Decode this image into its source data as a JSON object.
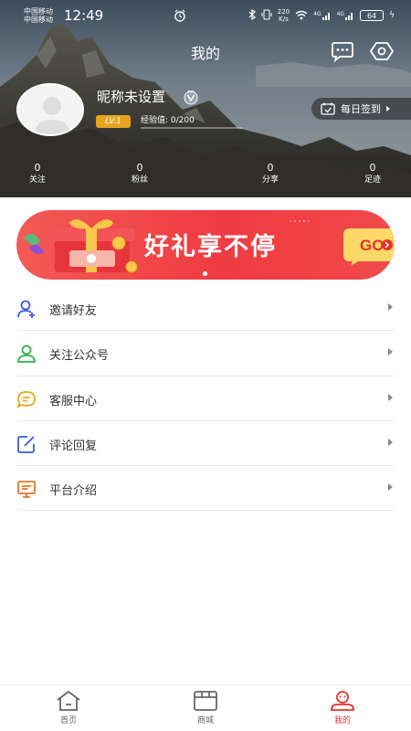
{
  "status_bar": {
    "carrier_1": "中国移动",
    "carrier_2": "中国移动",
    "time": "12:49",
    "net_speed_value": "220",
    "net_speed_unit": "K/s",
    "signal_1": "4G",
    "signal_2": "4G",
    "battery": "64"
  },
  "header": {
    "title": "我的",
    "message_icon": "chat-bubble-icon",
    "settings_icon": "settings-hexagon-icon"
  },
  "profile": {
    "nickname": "昵称未设置",
    "verified_icon": "v-badge-icon",
    "level": "LV.1",
    "experience_label": "经验值: 0/200",
    "experience_progress": 0,
    "signin_label": "每日签到"
  },
  "stats": [
    {
      "value": "0",
      "label": "关注"
    },
    {
      "value": "0",
      "label": "粉丝"
    },
    {
      "value": "0",
      "label": "分享"
    },
    {
      "value": "0",
      "label": "足迹"
    }
  ],
  "banner": {
    "text": "好礼享不停",
    "go_label": "GO",
    "accent_color": "#ef3b42"
  },
  "menu": [
    {
      "label": "邀请好友",
      "icon": "invite-user-icon",
      "color": "#3b5bdb"
    },
    {
      "label": "关注公众号",
      "icon": "follow-user-icon",
      "color": "#2bb24c"
    },
    {
      "label": "客服中心",
      "icon": "chat-message-icon",
      "color": "#e6a817"
    },
    {
      "label": "评论回复",
      "icon": "edit-comment-icon",
      "color": "#3b5bdb"
    },
    {
      "label": "平台介绍",
      "icon": "monitor-icon",
      "color": "#e8762b"
    }
  ],
  "tabbar": [
    {
      "label": "首页",
      "icon": "home-icon"
    },
    {
      "label": "商城",
      "icon": "store-icon"
    },
    {
      "label": "我的",
      "icon": "profile-icon",
      "active": true
    }
  ]
}
